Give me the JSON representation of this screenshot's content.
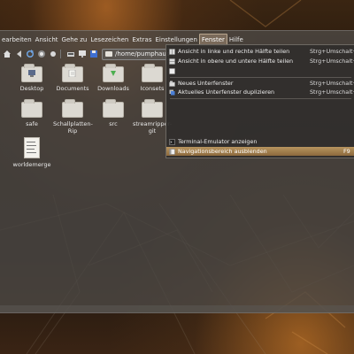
{
  "menubar": {
    "items": [
      "earbeiten",
      "Ansicht",
      "Gehe zu",
      "Lesezeichen",
      "Extras",
      "Einstellungen",
      "Fenster",
      "Hilfe"
    ],
    "active": "Fenster"
  },
  "toolbar": {
    "icons": [
      "home-icon",
      "back-icon",
      "refresh-icon",
      "zoom-icon",
      "stop-icon",
      "computer-icon",
      "monitor-icon",
      "floppy-icon"
    ],
    "path": "/home/pumphaus"
  },
  "files": [
    {
      "name": "Desktop",
      "icon": "folder-desktop-icon"
    },
    {
      "name": "Documents",
      "icon": "folder-documents-icon"
    },
    {
      "name": "Downloads",
      "icon": "folder-downloads-icon"
    },
    {
      "name": "Iconsets",
      "icon": "folder-iconsets-icon"
    },
    {
      "name": "safe",
      "icon": "folder-icon"
    },
    {
      "name": "Schallplatten-Rip",
      "icon": "folder-icon"
    },
    {
      "name": "src",
      "icon": "folder-icon"
    },
    {
      "name": "streamripper-git",
      "icon": "folder-icon"
    },
    {
      "name": "worldemerge",
      "icon": "text-document-icon"
    }
  ],
  "window_menu": {
    "items": [
      {
        "label": "Ansicht in linke und rechte Hälfte teilen",
        "accel": "Strg+Umschalt+L",
        "icon": "split-left-right-icon"
      },
      {
        "label": "Ansicht in obere und untere Hälfte teilen",
        "accel": "Strg+Umschalt+T",
        "icon": "split-top-bottom-icon"
      },
      {
        "label": "",
        "accel": "",
        "icon": "window-icon"
      },
      {
        "label": "Neues Unterfenster",
        "accel": "Strg+Umschalt+N",
        "icon": "new-tab-icon"
      },
      {
        "label": "Aktuelles Unterfenster duplizieren",
        "accel": "Strg+Umschalt+D",
        "icon": "duplicate-tab-icon"
      },
      {
        "label": "Terminal-Emulator anzeigen",
        "accel": "",
        "icon": "terminal-icon"
      },
      {
        "label": "Navigationsbereich ausblenden",
        "accel": "F9",
        "icon": "navigation-panel-icon"
      }
    ],
    "highlighted": "Navigationsbereich ausblenden"
  },
  "colors": {
    "accent": "#a8834f",
    "window_bg": "#4e4a46"
  }
}
